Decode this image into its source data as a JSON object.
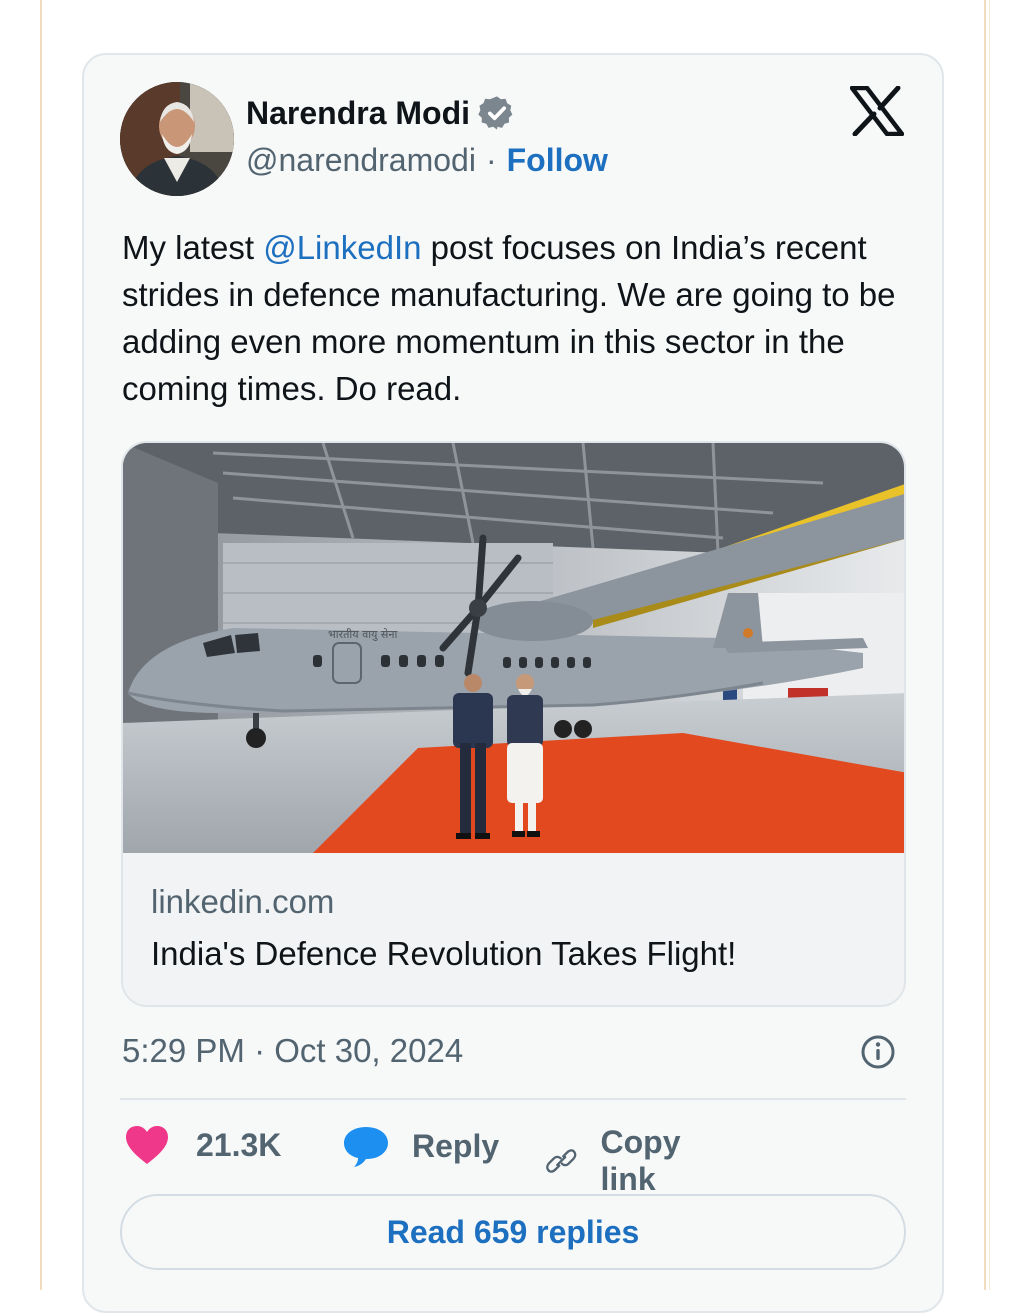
{
  "author": {
    "name": "Narendra Modi",
    "handle": "@narendramodi",
    "separator": "·",
    "follow_label": "Follow"
  },
  "tweet": {
    "text_before": "My latest ",
    "mention": "@LinkedIn",
    "text_after": " post focuses on India’s recent strides in defence manufacturing. We are going to be adding even more momentum in this sector in the coming times. Do read."
  },
  "link_card": {
    "domain": "linkedin.com",
    "title": "India's Defence Revolution Takes Flight!",
    "aircraft_text": "भारतीय वायु सेना"
  },
  "timestamp": "5:29 PM · Oct 30, 2024",
  "actions": {
    "likes": "21.3K",
    "reply_label": "Reply",
    "copy_label": "Copy link"
  },
  "read_replies_label": "Read 659 replies",
  "colors": {
    "accent": "#1d6fbf",
    "like": "#f0388a",
    "reply_icon": "#1d8ff0",
    "verified": "#7b868f"
  }
}
